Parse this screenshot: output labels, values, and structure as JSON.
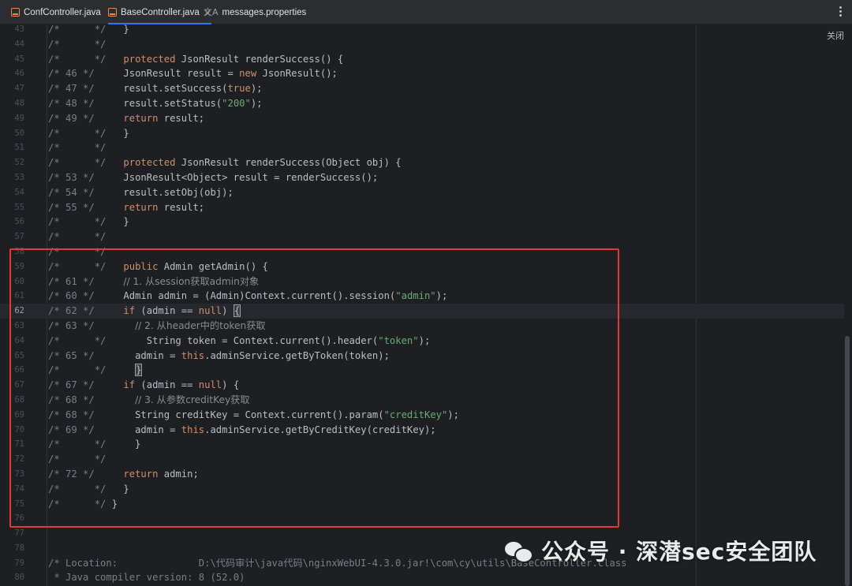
{
  "tabs": [
    {
      "label": "ConfController.java",
      "icon": "java-file-icon",
      "active": false
    },
    {
      "label": "BaseController.java",
      "icon": "java-file-icon",
      "active": true,
      "closable": true
    },
    {
      "label": "messages.properties",
      "icon": "properties-file-icon",
      "active": false
    }
  ],
  "close_label": "关闭",
  "current_line": 62,
  "lines": [
    {
      "n": 43,
      "html": "<span class='c'>/*      */</span>   }"
    },
    {
      "n": 44,
      "html": "<span class='c'>/*      */</span>"
    },
    {
      "n": 45,
      "html": "<span class='c'>/*      */</span>   <span class='k'>protected</span> JsonResult renderSuccess() {"
    },
    {
      "n": 46,
      "html": "<span class='c'>/* 46 */</span>     JsonResult result = <span class='k'>new</span> JsonResult();"
    },
    {
      "n": 47,
      "html": "<span class='c'>/* 47 */</span>     result.setSuccess(<span class='k'>true</span>);"
    },
    {
      "n": 48,
      "html": "<span class='c'>/* 48 */</span>     result.setStatus(<span class='s'>\"200\"</span>);"
    },
    {
      "n": 49,
      "html": "<span class='c'>/* 49 */</span>     <span class='k'>return</span> result;"
    },
    {
      "n": 50,
      "html": "<span class='c'>/*      */</span>   }"
    },
    {
      "n": 51,
      "html": "<span class='c'>/*      */</span>"
    },
    {
      "n": 52,
      "html": "<span class='c'>/*      */</span>   <span class='k'>protected</span> JsonResult renderSuccess(Object obj) {"
    },
    {
      "n": 53,
      "html": "<span class='c'>/* 53 */</span>     JsonResult&lt;Object&gt; result = renderSuccess();"
    },
    {
      "n": 54,
      "html": "<span class='c'>/* 54 */</span>     result.setObj(obj);"
    },
    {
      "n": 55,
      "html": "<span class='c'>/* 55 */</span>     <span class='k'>return</span> result;"
    },
    {
      "n": 56,
      "html": "<span class='c'>/*      */</span>   }"
    },
    {
      "n": 57,
      "html": "<span class='c'>/*      */</span>"
    },
    {
      "n": 58,
      "html": "<span class='c'>/*      */</span>"
    },
    {
      "n": 59,
      "html": "<span class='c'>/*      */</span>   <span class='k'>public</span> Admin getAdmin() {"
    },
    {
      "n": 60,
      "html": "<span class='c'>/* 61 */</span>     <span class='cm'>// 1. 从session获取admin对象</span>"
    },
    {
      "n": 61,
      "html": "<span class='c'>/* 60 */</span>     Admin admin = (Admin)Context.current().session(<span class='s'>\"admin\"</span>);"
    },
    {
      "n": 62,
      "html": "<span class='c'>/* 62 */</span>     <span class='k'>if</span> (admin == <span class='k'>null</span>) <span class='hl'>{</span>"
    },
    {
      "n": 63,
      "html": "<span class='c'>/* 63 */</span>       <span class='cm'>// 2. 从header中的token获取</span>"
    },
    {
      "n": 64,
      "html": "<span class='c'>/*      */</span>       String token = Context.current().header(<span class='s'>\"token\"</span>);"
    },
    {
      "n": 65,
      "html": "<span class='c'>/* 65 */</span>       admin = <span class='k'>this</span>.adminService.getByToken(token);"
    },
    {
      "n": 66,
      "html": "<span class='c'>/*      */</span>     <span class='hl'>}</span>"
    },
    {
      "n": 67,
      "html": "<span class='c'>/* 67 */</span>     <span class='k'>if</span> (admin == <span class='k'>null</span>) {"
    },
    {
      "n": 68,
      "html": "<span class='c'>/* 68 */</span>       <span class='cm'>// 3. 从参数creditKey获取</span>"
    },
    {
      "n": 69,
      "html": "<span class='c'>/* 68 */</span>       String creditKey = Context.current().param(<span class='s'>\"creditKey\"</span>);"
    },
    {
      "n": 70,
      "html": "<span class='c'>/* 69 */</span>       admin = <span class='k'>this</span>.adminService.getByCreditKey(creditKey);"
    },
    {
      "n": 71,
      "html": "<span class='c'>/*      */</span>     }"
    },
    {
      "n": 72,
      "html": "<span class='c'>/*      */</span>"
    },
    {
      "n": 73,
      "html": "<span class='c'>/* 72 */</span>     <span class='k'>return</span> admin;"
    },
    {
      "n": 74,
      "html": "<span class='c'>/*      */</span>   }"
    },
    {
      "n": 75,
      "html": "<span class='c'>/*      */</span> }"
    },
    {
      "n": 76,
      "html": ""
    },
    {
      "n": 77,
      "html": ""
    },
    {
      "n": 78,
      "html": ""
    },
    {
      "n": 79,
      "html": "<span class='c'>/* Location:              D:\\代码审计\\java代码\\nginxWebUI-4.3.0.jar!\\com\\cy\\utils\\BaseController.class</span>"
    },
    {
      "n": 80,
      "html": "<span class='c'> * Java compiler version: 8 (52.0)</span>"
    }
  ],
  "watermark": "公众号 · 深潜sec安全团队"
}
